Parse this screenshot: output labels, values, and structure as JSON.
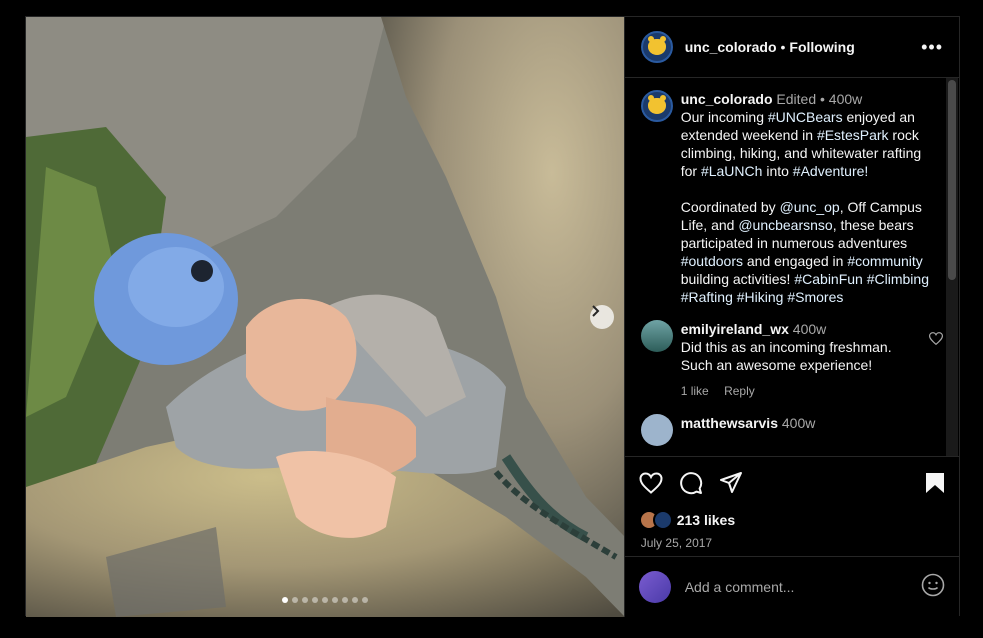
{
  "post": {
    "author": "unc_colorado",
    "follow_status": "Following",
    "separator": "•",
    "more": "•••",
    "caption": {
      "username": "unc_colorado",
      "edited": "Edited",
      "dot": "•",
      "age": "400w",
      "text_1": "Our incoming ",
      "tag_1": "#UNCBears",
      "text_2": " enjoyed an extended weekend in ",
      "tag_2": "#EstesPark",
      "text_3": " rock climbing, hiking, and whitewater rafting for ",
      "tag_3": "#LaUNCh",
      "text_4": " into ",
      "tag_4": "#Adventure!",
      "text_5": "Coordinated by ",
      "tag_5": "@unc_op",
      "text_6": ", Off Campus Life, and ",
      "tag_6": "@uncbearsnso",
      "text_7": ", these bears participated in numerous adventures ",
      "tag_7": "#outdoors",
      "text_8": " and engaged in ",
      "tag_8": "#community",
      "text_9": " building activities! ",
      "tag_9": "#CabinFun",
      "tag_10": "#Climbing",
      "tag_11": "#Rafting",
      "tag_12": "#Hiking",
      "tag_13": "#Smores"
    },
    "comments": [
      {
        "username": "emilyireland_wx",
        "age": "400w",
        "text": "Did this as an incoming freshman. Such an awesome experience!",
        "likes": "1 like",
        "reply": "Reply"
      },
      {
        "username": "matthewsarvis",
        "age": "400w"
      }
    ],
    "likes": "213 likes",
    "date": "July 25, 2017",
    "comment_placeholder": "Add a comment...",
    "carousel": {
      "count": 9,
      "active": 0
    }
  },
  "icons": {
    "next": "chevron-right-icon",
    "like": "heart-icon",
    "comment": "comment-icon",
    "share": "share-icon",
    "save": "bookmark-icon",
    "emoji": "emoji-icon"
  }
}
